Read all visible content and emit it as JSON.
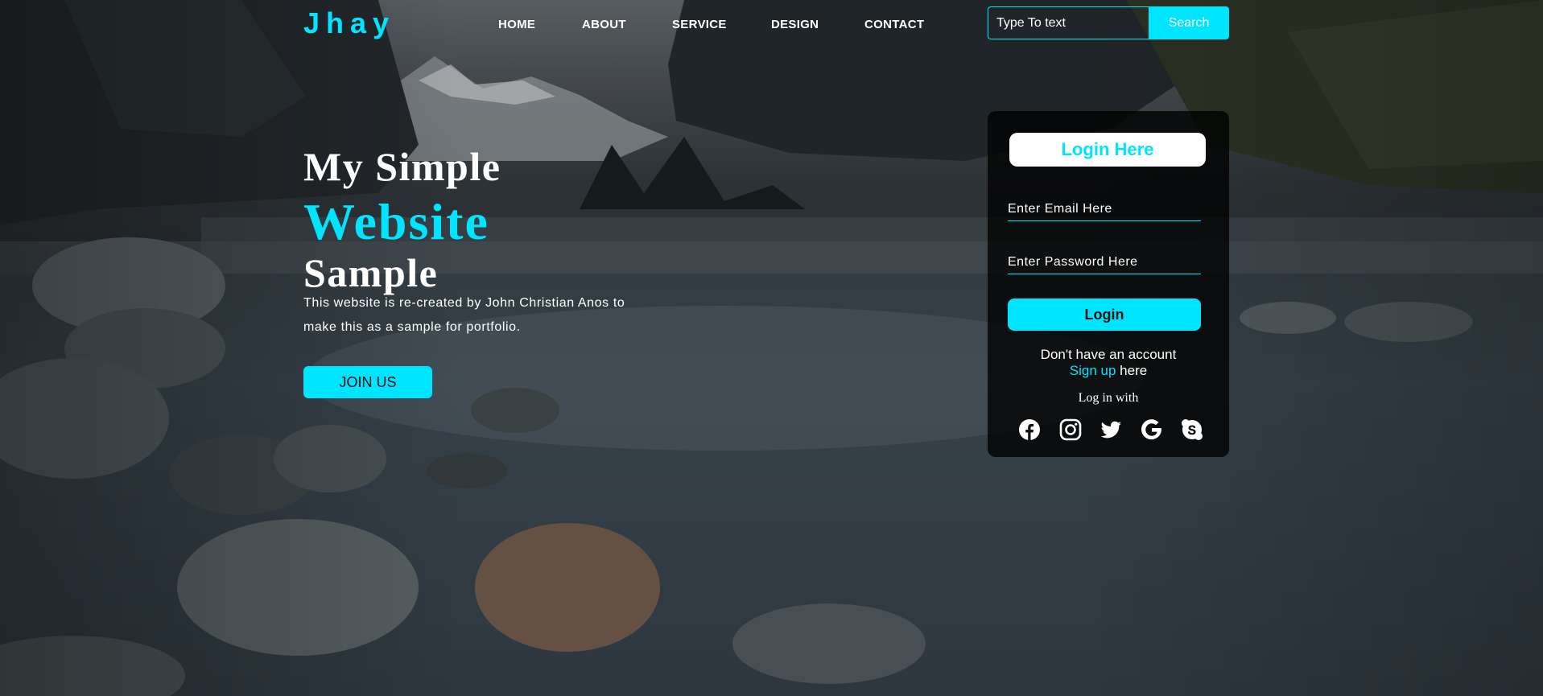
{
  "header": {
    "logo": "Jhay",
    "nav": [
      "HOME",
      "ABOUT",
      "SERVICE",
      "DESIGN",
      "CONTACT"
    ],
    "search": {
      "placeholder": "Type To text",
      "button_label": "Search"
    }
  },
  "hero": {
    "title_line1": "My Simple",
    "title_line2": "Website",
    "title_line3": "Sample",
    "description": "This website is re-created by John Christian Anos to make this as a sample for portfolio.",
    "join_label": "JOIN US"
  },
  "login": {
    "title": "Login Here",
    "email_placeholder": "Enter Email Here",
    "password_placeholder": "Enter Password Here",
    "button_label": "Login",
    "no_account_text": "Don't have an account",
    "signup_link": "Sign up",
    "signup_suffix": " here",
    "login_with": "Log in with",
    "social_icons": [
      "facebook-icon",
      "instagram-icon",
      "twitter-icon",
      "google-icon",
      "skype-icon"
    ]
  },
  "colors": {
    "accent": "#00e5ff",
    "text": "#ffffff",
    "card_bg": "rgba(0,0,0,0.78)"
  }
}
